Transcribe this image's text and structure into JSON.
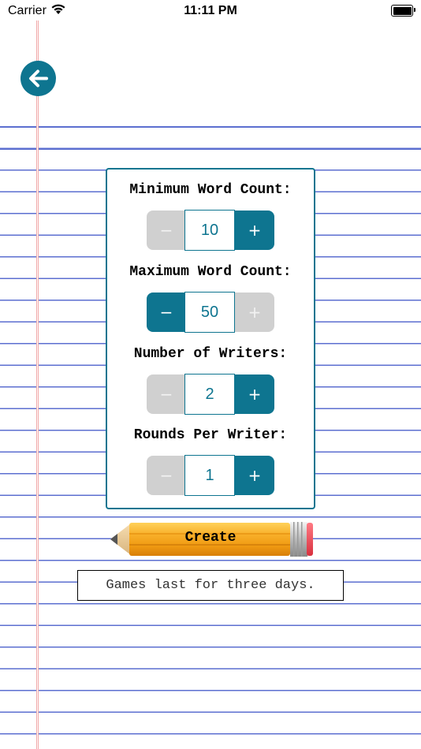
{
  "status_bar": {
    "carrier": "Carrier",
    "time": "11:11 PM"
  },
  "colors": {
    "accent": "#0e7590",
    "disabled": "#d0d0d0",
    "paper_line": "#5c6fd0",
    "margin_line": "#f0a8a8",
    "pencil_body": "#f5a51e"
  },
  "back_button": {
    "icon": "arrow-left-icon"
  },
  "settings": {
    "min_word_count": {
      "label": "Minimum Word Count:",
      "value": "10",
      "minus": "−",
      "plus": "+"
    },
    "max_word_count": {
      "label": "Maximum Word Count:",
      "value": "50",
      "minus": "−",
      "plus": "+"
    },
    "num_writers": {
      "label": "Number of Writers:",
      "value": "2",
      "minus": "−",
      "plus": "+"
    },
    "rounds_per_writer": {
      "label": "Rounds Per Writer:",
      "value": "1",
      "minus": "−",
      "plus": "+"
    }
  },
  "create_button": {
    "label": "Create",
    "icon": "pencil-icon"
  },
  "info_text": "Games last for three days."
}
